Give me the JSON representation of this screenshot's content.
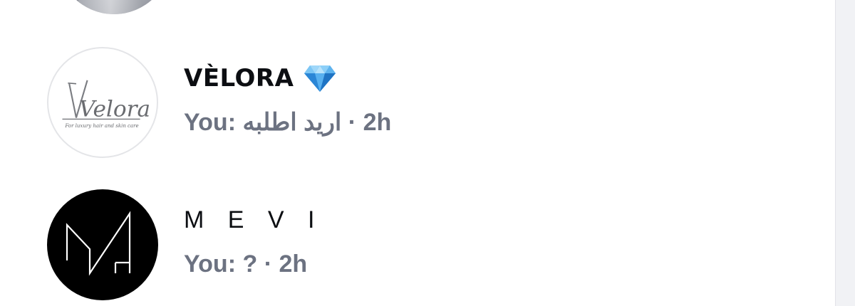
{
  "conversations": [
    {
      "name": "VÈLORA",
      "badge_icon": "gem-icon",
      "preview_sender": "You: ",
      "preview_text": "اريد اطلبه",
      "separator": " · ",
      "time": "2h",
      "avatar": {
        "logo_text": "Velora",
        "tagline": "For luxury hair and skin care"
      }
    },
    {
      "name": "M E V I",
      "preview_sender": "You: ",
      "preview_text": "?",
      "separator": " · ",
      "time": "2h",
      "avatar": {
        "logo": "MV monogram"
      }
    }
  ],
  "colors": {
    "name_text": "#0c0e12",
    "preview_text": "#6c7281",
    "scrollbar_track": "#f1f2f5",
    "gem_blue": "#3a9ee8"
  }
}
